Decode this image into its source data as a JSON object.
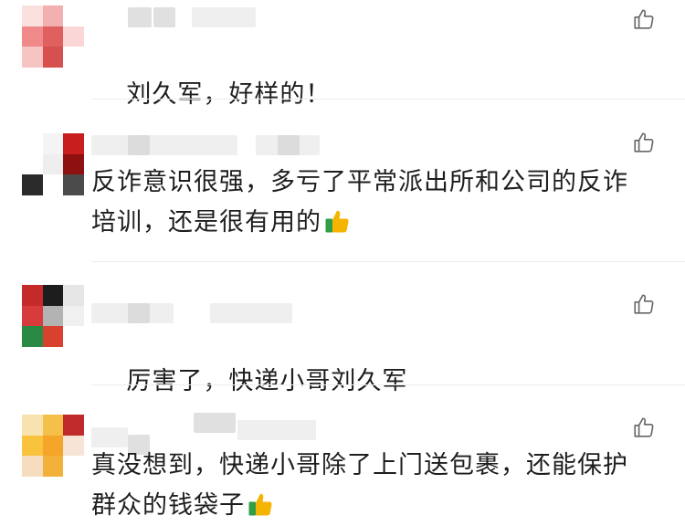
{
  "comments": [
    {
      "text": "刘久军，好样的！",
      "emoji": ""
    },
    {
      "text": "反诈意识很强，多亏了平常派出所和公司的反诈培训，还是很有用的",
      "emoji": "thumbs-up"
    },
    {
      "text": "厉害了，快递小哥刘久军",
      "emoji": ""
    },
    {
      "text": "真没想到，快递小哥除了上门送包裹，还能保护群众的钱袋子",
      "emoji": "thumbs-up"
    }
  ],
  "icons": {
    "like": "thumbs-up-outline-icon",
    "emoji": "thumbs-up-emoji-icon"
  },
  "colors": {
    "text": "#1e1e1e",
    "icon": "#666666",
    "divider": "#ececec",
    "emoji_hand": "#f5b400",
    "emoji_cuff": "#2f9e44"
  }
}
